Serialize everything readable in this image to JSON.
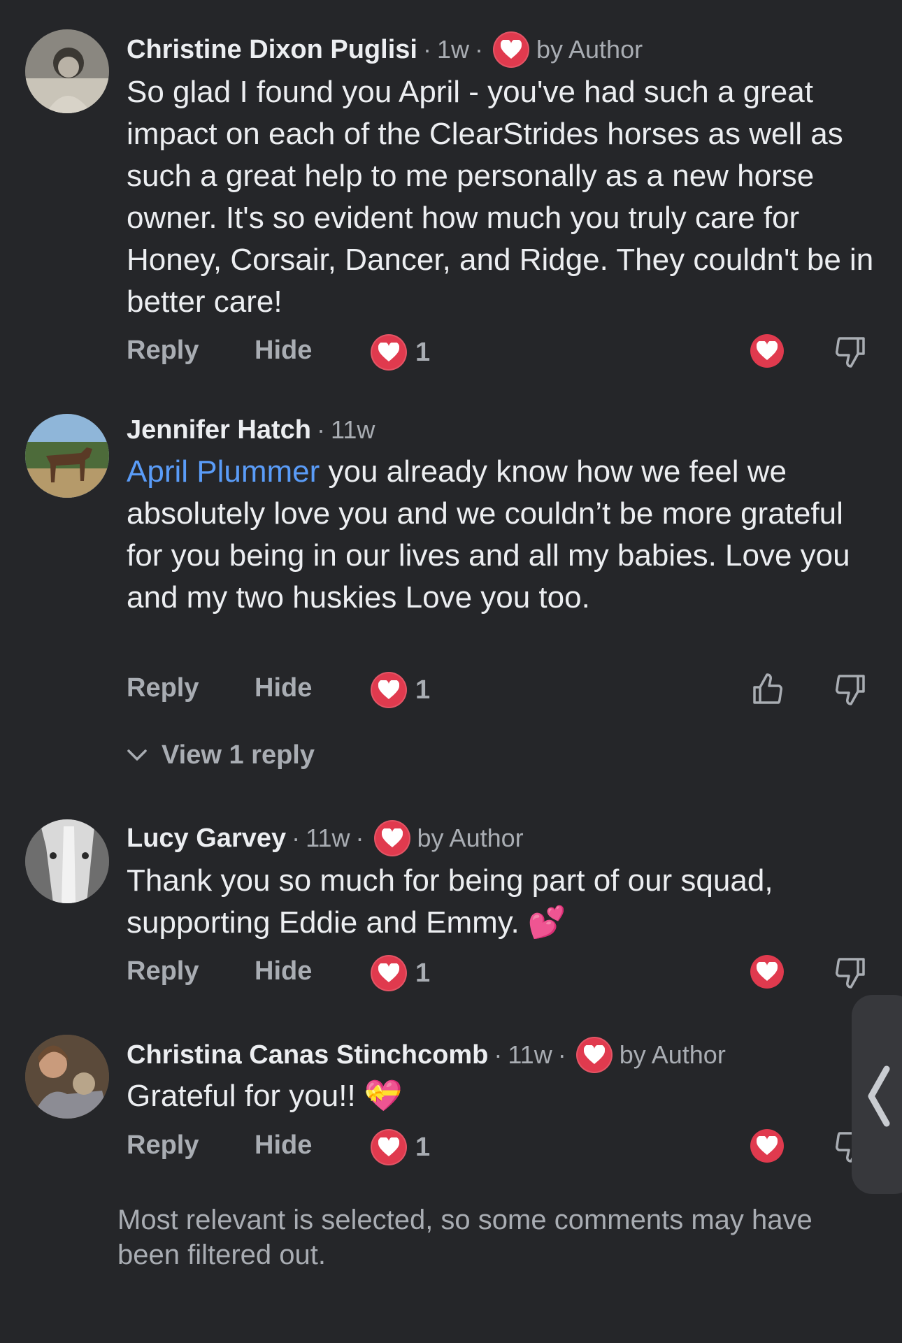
{
  "comments": [
    {
      "name": "Christine Dixon Puglisi",
      "time": "1w",
      "liked_by_author": true,
      "by_author_label": "by Author",
      "mention": "",
      "text": "So glad I found you April - you've had such a great impact on each of the ClearStrides horses as well as such a great help to me personally as a new horse owner. It's so evident how much you truly care for Honey, Corsair, Dancer, and Ridge. They couldn't be in better care!",
      "reply_label": "Reply",
      "hide_label": "Hide",
      "reaction_count": "1",
      "my_reaction": "heart"
    },
    {
      "name": "Jennifer Hatch",
      "time": "11w",
      "liked_by_author": false,
      "by_author_label": "",
      "mention": "April Plummer",
      "text": "you already know how we feel we absolutely love you and we couldn’t be more grateful for you being in our lives and all my babies. Love you and my two huskies Love you too.",
      "reply_label": "Reply",
      "hide_label": "Hide",
      "reaction_count": "1",
      "my_reaction": "thumb-up-outline",
      "view_replies_label": "View 1 reply"
    },
    {
      "name": "Lucy Garvey",
      "time": "11w",
      "liked_by_author": true,
      "by_author_label": "by Author",
      "mention": "",
      "text": "Thank you so much for being part of our squad, supporting Eddie and Emmy. 💕",
      "reply_label": "Reply",
      "hide_label": "Hide",
      "reaction_count": "1",
      "my_reaction": "heart"
    },
    {
      "name": "Christina Canas Stinchcomb",
      "time": "11w",
      "liked_by_author": true,
      "by_author_label": "by Author",
      "mention": "",
      "text": "Grateful for you!! 💝",
      "reply_label": "Reply",
      "hide_label": "Hide",
      "reaction_count": "1",
      "my_reaction": "heart"
    }
  ],
  "footer_note": "Most relevant is selected, so some comments may have been filtered out.",
  "colors": {
    "background": "#252629",
    "heart": "#e03a4e",
    "mention": "#5a9cf8",
    "secondary_text": "#a9adb3"
  },
  "icons": [
    "heart-icon",
    "thumb-up-icon",
    "thumb-down-icon",
    "chevron-down-icon",
    "chevron-left-icon"
  ]
}
